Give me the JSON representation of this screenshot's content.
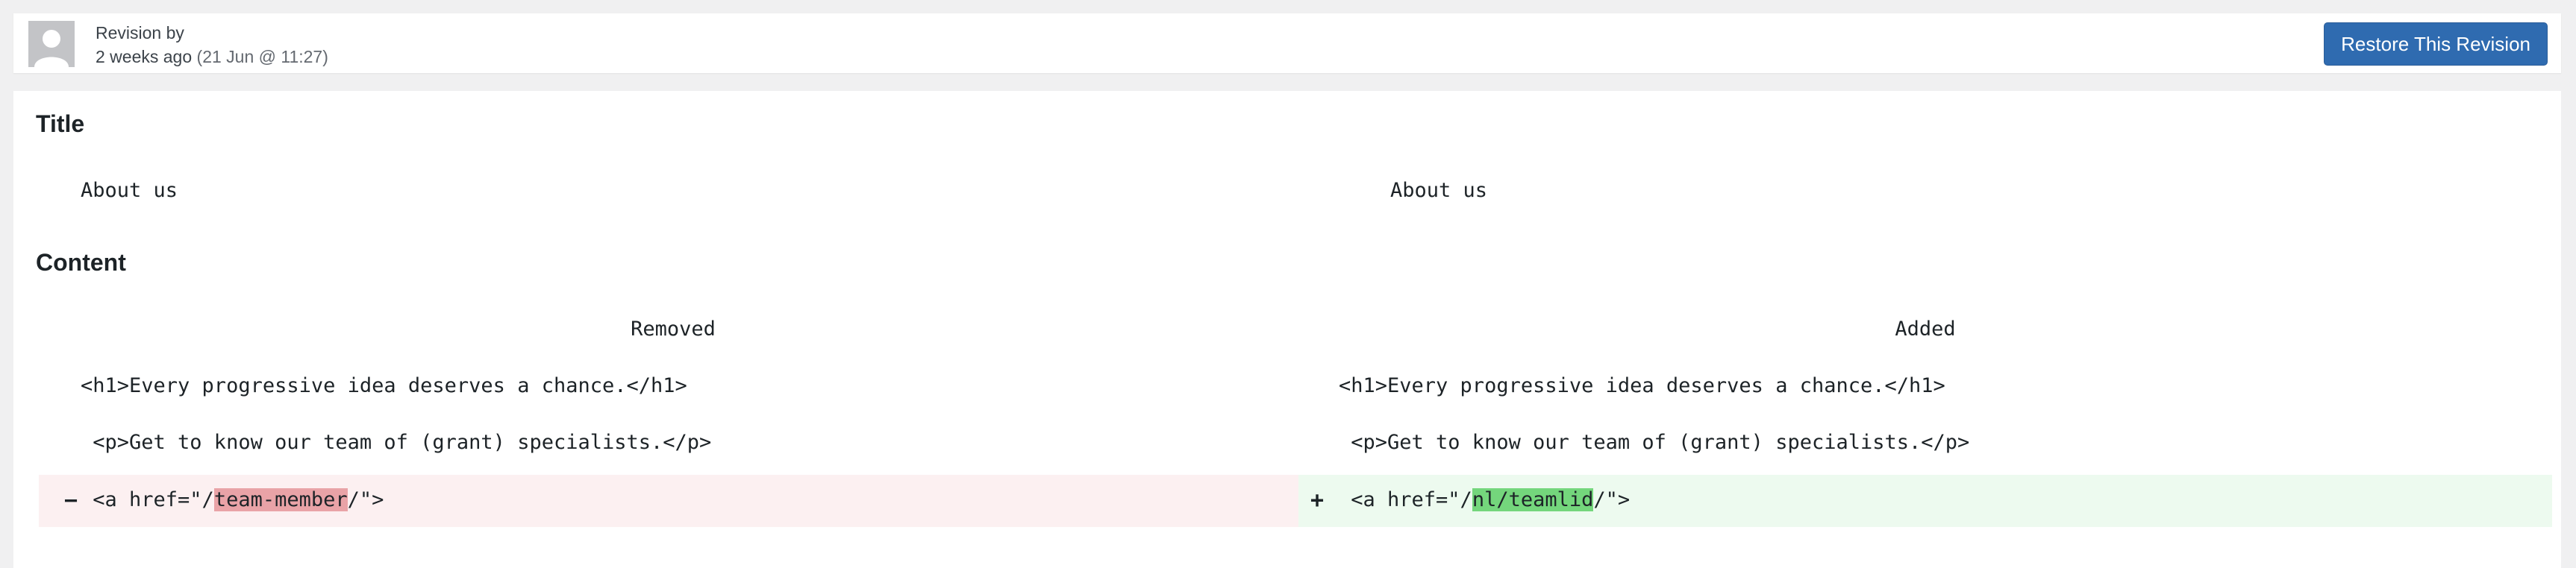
{
  "header": {
    "revision_by_label": "Revision by",
    "time_ago": "2 weeks ago",
    "date": "(21 Jun @ 11:27)",
    "restore_button": "Restore This Revision"
  },
  "colors": {
    "restore_button_bg": "#2f6bb0",
    "removed_row_bg": "#fcf0f1",
    "removed_highlight": "#e9a3a7",
    "added_row_bg": "#edfaef",
    "added_highlight": "#74d67c"
  },
  "title_section": {
    "heading": "Title",
    "old": "About us",
    "new": "About us"
  },
  "content_section": {
    "heading": "Content",
    "removed_header": "Removed",
    "added_header": "Added",
    "lines": [
      {
        "old": "<h1>Every progressive idea deserves a chance.</h1>",
        "new": "<h1>Every progressive idea deserves a chance.</h1>"
      },
      {
        "old": " <p>Get to know our team of (grant) specialists.</p>",
        "new": " <p>Get to know our team of (grant) specialists.</p>"
      }
    ],
    "changed_line": {
      "removed_marker": "−",
      "added_marker": "+",
      "old_prefix": " <a href=\"/",
      "old_changed": "team-member",
      "old_suffix": "/\">",
      "new_prefix": " <a href=\"/",
      "new_changed": "nl/teamlid",
      "new_suffix": "/\">"
    }
  }
}
